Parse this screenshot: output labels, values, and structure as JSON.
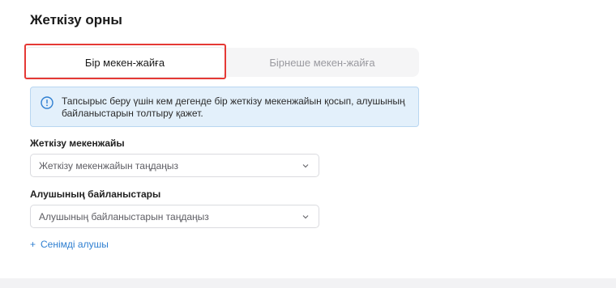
{
  "section": {
    "title": "Жеткізу орны"
  },
  "tabs": [
    {
      "label": "Бір мекен-жайға",
      "active": true
    },
    {
      "label": "Бірнеше мекен-жайға",
      "active": false
    }
  ],
  "info": {
    "line1": "Тапсырыс беру үшін кем дегенде бір жеткізу мекенжайын қосып, алушының",
    "line2": "байланыстарын толтыру қажет."
  },
  "address": {
    "label": "Жеткізу мекенжайы",
    "placeholder": "Жеткізу мекенжайын таңдаңыз"
  },
  "recipient": {
    "label": "Алушының байланыстары",
    "placeholder": "Алушының байланыстарын таңдаңыз"
  },
  "add_trusted": {
    "plus": "+",
    "label": "Сенімді алушы"
  },
  "colors": {
    "accent": "#2f7fd1",
    "highlight": "#e53935",
    "info_bg": "#e3f0fb",
    "info_border": "#b9d6f1"
  },
  "icons": {
    "info": "info-circle-icon",
    "chevron": "chevron-down-icon"
  }
}
